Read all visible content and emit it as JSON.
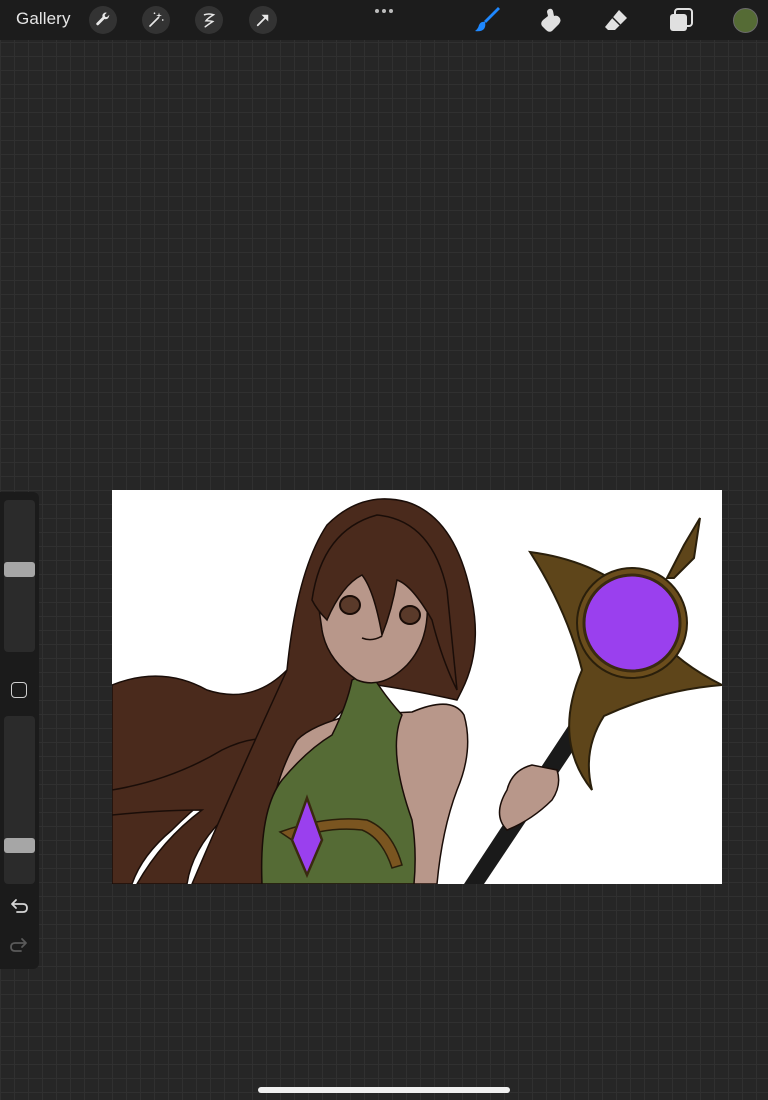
{
  "topbar": {
    "gallery_label": "Gallery",
    "left_tools": [
      {
        "icon": "wrench-icon"
      },
      {
        "icon": "magic-wand-icon"
      },
      {
        "icon": "selection-icon"
      },
      {
        "icon": "transform-arrow-icon"
      }
    ],
    "right_tools": [
      {
        "icon": "brush-icon",
        "active": true
      },
      {
        "icon": "smudge-icon",
        "active": false
      },
      {
        "icon": "eraser-icon",
        "active": false
      },
      {
        "icon": "layers-icon",
        "active": false
      }
    ],
    "active_color": "#556b35"
  },
  "sidebar": {
    "brush_size_level": 0.55,
    "opacity_level": 0.2,
    "undo_icon": "undo-icon",
    "redo_icon": "redo-icon"
  },
  "colors": {
    "accent": "#1e88ff",
    "hair": "#4a2a1c",
    "skin": "#b8978a",
    "dress": "#556b35",
    "gem": "#9a40ee",
    "staff_gold": "#5e451a"
  }
}
